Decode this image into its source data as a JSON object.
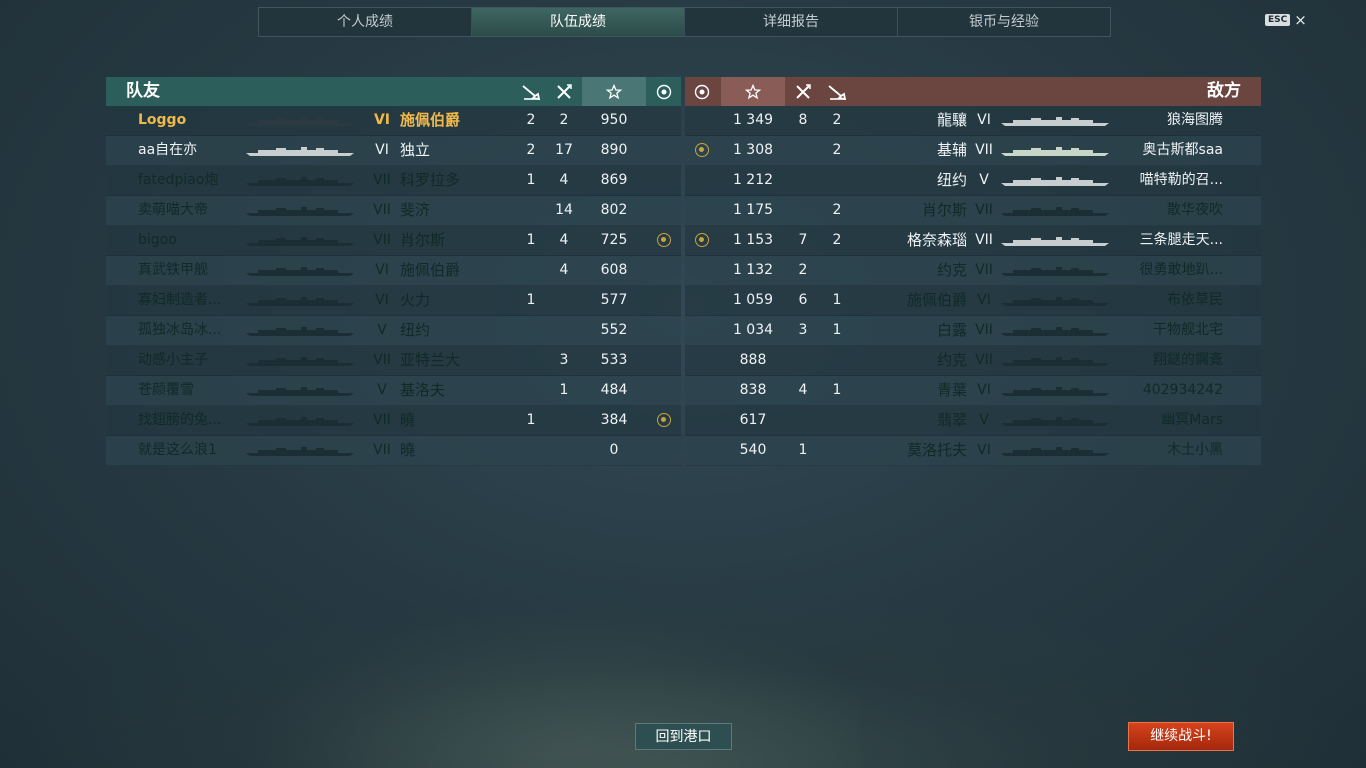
{
  "tabs": [
    "个人成绩",
    "队伍成绩",
    "详细报告",
    "银币与经验"
  ],
  "esc": {
    "key": "ESC",
    "close": "×"
  },
  "allies": {
    "title": "队友",
    "header_icons": [
      "torpedo-icon",
      "plane-icon",
      "star-icon",
      "medal-icon"
    ],
    "rows": [
      {
        "name": "Loggo",
        "tier": "VI",
        "ship": "施佩伯爵",
        "torp": "2",
        "plane": "2",
        "score": "950",
        "medal": false,
        "style": "me",
        "ship_color": "#2a3a40"
      },
      {
        "name": "aa自在亦",
        "tier": "VI",
        "ship": "独立",
        "torp": "2",
        "plane": "17",
        "score": "890",
        "medal": false,
        "style": "white",
        "ship_color": "#c8cdd0"
      },
      {
        "name": "fatedpiao炮",
        "tier": "VII",
        "ship": "科罗拉多",
        "torp": "1",
        "plane": "4",
        "score": "869",
        "medal": false,
        "style": "dim",
        "ship_color": "#1a2e33"
      },
      {
        "name": "卖萌喵大帝",
        "tier": "VII",
        "ship": "斐济",
        "torp": "",
        "plane": "14",
        "score": "802",
        "medal": false,
        "style": "dim",
        "ship_color": "#1a2e33"
      },
      {
        "name": "bigoo",
        "tier": "VII",
        "ship": "肖尔斯",
        "torp": "1",
        "plane": "4",
        "score": "725",
        "medal": true,
        "style": "dim",
        "ship_color": "#1a2e33"
      },
      {
        "name": "真武铁甲舰",
        "tier": "VI",
        "ship": "施佩伯爵",
        "torp": "",
        "plane": "4",
        "score": "608",
        "medal": false,
        "style": "dim",
        "ship_color": "#1a2e33"
      },
      {
        "name": "寡妇制造者...",
        "tier": "VI",
        "ship": "火力",
        "torp": "1",
        "plane": "",
        "score": "577",
        "medal": false,
        "style": "dim",
        "ship_color": "#1a2e33"
      },
      {
        "name": "孤独冰岛冰...",
        "tier": "V",
        "ship": "纽约",
        "torp": "",
        "plane": "",
        "score": "552",
        "medal": false,
        "style": "dim",
        "ship_color": "#1a2e33"
      },
      {
        "name": "动感小主子",
        "tier": "VII",
        "ship": "亚特兰大",
        "torp": "",
        "plane": "3",
        "score": "533",
        "medal": false,
        "style": "dim",
        "ship_color": "#1a2e33"
      },
      {
        "name": "苍颜覆雪",
        "tier": "V",
        "ship": "基洛夫",
        "torp": "",
        "plane": "1",
        "score": "484",
        "medal": false,
        "style": "dim",
        "ship_color": "#1a2e33"
      },
      {
        "name": "找翅膀的兔...",
        "tier": "VII",
        "ship": "曉",
        "torp": "1",
        "plane": "",
        "score": "384",
        "medal": true,
        "style": "dim",
        "ship_color": "#1a2e33"
      },
      {
        "name": "就是这么浪1",
        "tier": "VII",
        "ship": "曉",
        "torp": "",
        "plane": "",
        "score": "0",
        "medal": false,
        "style": "dim",
        "ship_color": "#1a2e33"
      }
    ]
  },
  "enemies": {
    "title": "敌方",
    "header_icons": [
      "medal-icon",
      "star-icon",
      "plane-icon",
      "torpedo-icon"
    ],
    "rows": [
      {
        "name": "狼海图腾",
        "tier": "VI",
        "ship": "龍驤",
        "torp": "2",
        "plane": "8",
        "score": "1 349",
        "medal": false,
        "style": "white",
        "ship_color": "#c8cdd0"
      },
      {
        "name": "奥古斯都saa",
        "tier": "VII",
        "ship": "基辅",
        "torp": "2",
        "plane": "",
        "score": "1 308",
        "medal": true,
        "style": "white",
        "ship_color": "#c8d6c8"
      },
      {
        "name": "喵特勒的召...",
        "tier": "V",
        "ship": "纽约",
        "torp": "",
        "plane": "",
        "score": "1 212",
        "medal": false,
        "style": "white",
        "ship_color": "#c8cdd0"
      },
      {
        "name": "散华夜吹",
        "tier": "VII",
        "ship": "肖尔斯",
        "torp": "2",
        "plane": "",
        "score": "1 175",
        "medal": false,
        "style": "dim",
        "ship_color": "#1a2e33"
      },
      {
        "name": "三条腿走天...",
        "tier": "VII",
        "ship": "格奈森瑙",
        "torp": "2",
        "plane": "7",
        "score": "1 153",
        "medal": true,
        "style": "white",
        "ship_color": "#c8cdd0"
      },
      {
        "name": "很勇敢地趴...",
        "tier": "VII",
        "ship": "约克",
        "torp": "",
        "plane": "2",
        "score": "1 132",
        "medal": false,
        "style": "dim",
        "ship_color": "#1a2e33"
      },
      {
        "name": "布依草民",
        "tier": "VI",
        "ship": "施佩伯爵",
        "torp": "1",
        "plane": "6",
        "score": "1 059",
        "medal": false,
        "style": "dim",
        "ship_color": "#1a2e33"
      },
      {
        "name": "干物舰北宅",
        "tier": "VII",
        "ship": "白露",
        "torp": "1",
        "plane": "3",
        "score": "1 034",
        "medal": false,
        "style": "dim",
        "ship_color": "#1a2e33"
      },
      {
        "name": "翔鎹的鐊斍",
        "tier": "VII",
        "ship": "约克",
        "torp": "",
        "plane": "",
        "score": "888",
        "medal": false,
        "style": "dim",
        "ship_color": "#1a2e33"
      },
      {
        "name": "402934242",
        "tier": "VI",
        "ship": "青葉",
        "torp": "1",
        "plane": "4",
        "score": "838",
        "medal": false,
        "style": "dim",
        "ship_color": "#1a2e33"
      },
      {
        "name": "幽冥Mars",
        "tier": "V",
        "ship": "翡翠",
        "torp": "",
        "plane": "",
        "score": "617",
        "medal": false,
        "style": "dim",
        "ship_color": "#1a2e33"
      },
      {
        "name": "木土小黑",
        "tier": "VI",
        "ship": "莫洛托夫",
        "torp": "",
        "plane": "1",
        "score": "540",
        "medal": false,
        "style": "dim",
        "ship_color": "#1a2e33"
      }
    ]
  },
  "buttons": {
    "port": "回到港口",
    "battle": "继续战斗!"
  },
  "colors": {
    "ally_header": "#2c5f5c",
    "enemy_header": "#6b4540",
    "highlight": "#f0b94a",
    "battle_button": "#c2361a"
  }
}
